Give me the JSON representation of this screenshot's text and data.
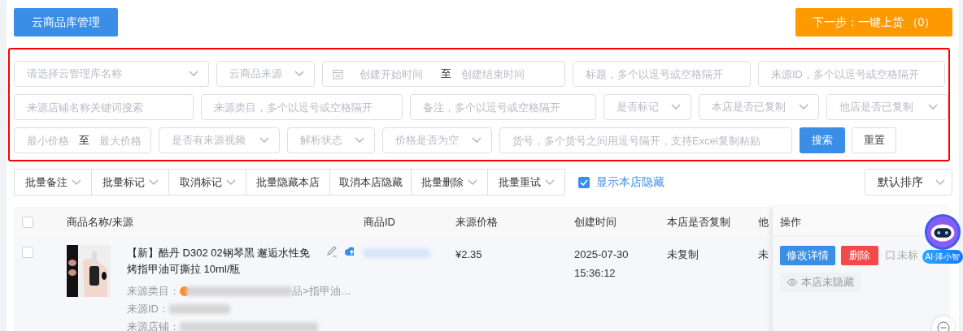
{
  "header": {
    "library_button": "云商品库管理",
    "next_button": "下一步：一键上货 （0）"
  },
  "filters": {
    "rows": [
      [
        {
          "kind": "select",
          "placeholder": "请选择云管理库名称"
        },
        {
          "kind": "select",
          "placeholder": "云商品来源"
        },
        {
          "kind": "date_range",
          "start_placeholder": "创建开始时间",
          "separator": "至",
          "end_placeholder": "创建结束时间"
        },
        {
          "kind": "input",
          "placeholder": "标题，多个以逗号或空格隔开"
        },
        {
          "kind": "input",
          "placeholder": "来源ID，多个以逗号或空格隔开"
        }
      ],
      [
        {
          "kind": "input",
          "placeholder": "来源店铺名称关键词搜索"
        },
        {
          "kind": "input",
          "placeholder": "来源类目，多个以逗号或空格隔开"
        },
        {
          "kind": "input",
          "placeholder": "备注，多个以逗号或空格隔开"
        },
        {
          "kind": "select",
          "placeholder": "是否标记"
        },
        {
          "kind": "select",
          "placeholder": "本店是否已复制"
        },
        {
          "kind": "select",
          "placeholder": "他店是否已复制"
        }
      ],
      [
        {
          "kind": "price_range",
          "start_placeholder": "最小价格",
          "separator": "至",
          "end_placeholder": "最大价格"
        },
        {
          "kind": "select",
          "placeholder": "是否有来源视频"
        },
        {
          "kind": "select",
          "placeholder": "解析状态"
        },
        {
          "kind": "select",
          "placeholder": "价格是否为空"
        },
        {
          "kind": "input",
          "placeholder": "货号，多个货号之间用逗号隔开，支持Excel复制粘贴"
        }
      ]
    ],
    "search_button": "搜索",
    "reset_button": "重置"
  },
  "toolbar": {
    "actions": [
      {
        "label": "批量备注",
        "dropdown": true
      },
      {
        "label": "批量标记",
        "dropdown": true
      },
      {
        "label": "取消标记",
        "dropdown": true
      },
      {
        "label": "批量隐藏本店",
        "dropdown": false
      },
      {
        "label": "取消本店隐藏",
        "dropdown": false
      },
      {
        "label": "批量删除",
        "dropdown": true
      },
      {
        "label": "批量重试",
        "dropdown": true
      }
    ],
    "show_hidden": {
      "label": "显示本店隐藏",
      "checked": true
    },
    "sort": {
      "value": "默认排序"
    }
  },
  "table": {
    "select_all_checked": false,
    "columns": [
      "商品名称/来源",
      "商品ID",
      "来源价格",
      "创建时间",
      "本店是否复制",
      "他",
      "操作"
    ],
    "rows": [
      {
        "checked": false,
        "title": "【新】酷丹 D302 02钢琴黑 邂逅水性免烤指甲油可撕拉 10ml/瓶",
        "category_label": "来源类目：",
        "category_tail": "品>指甲油…",
        "source_id_label": "来源ID：",
        "shop_label": "来源店铺：",
        "price": "¥2.35",
        "created": "2025-07-30 15:36:12",
        "copied_here": "未复制",
        "copied_other": "未",
        "actions": {
          "edit": "修改详情",
          "delete": "删除",
          "mark": "未标",
          "hidden": "本店未隐藏"
        }
      }
    ]
  },
  "assistant": {
    "label": "AI·泽小智"
  }
}
